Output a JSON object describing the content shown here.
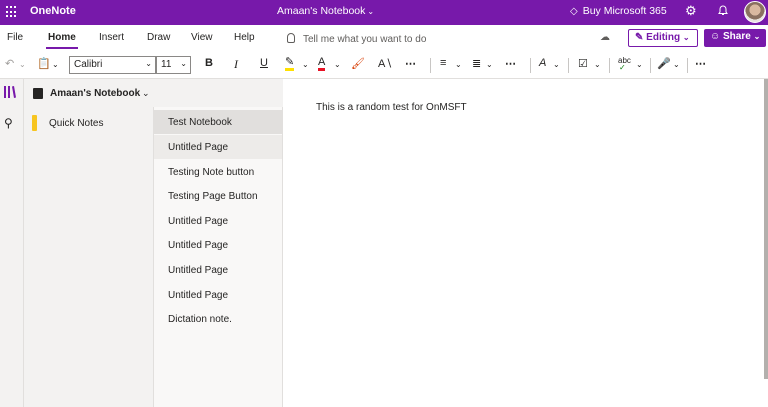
{
  "titlebar": {
    "app_name": "OneNote",
    "notebook_title": "Amaan's Notebook",
    "buy_label": "Buy Microsoft 365",
    "bg_color": "#7719aa"
  },
  "tabs": [
    {
      "label": "File"
    },
    {
      "label": "Home"
    },
    {
      "label": "Insert"
    },
    {
      "label": "Draw"
    },
    {
      "label": "View"
    },
    {
      "label": "Help"
    }
  ],
  "tellme_placeholder": "Tell me what you want to do",
  "editing_label": "Editing",
  "share_label": "Share",
  "toolbar": {
    "font_name": "Calibri",
    "font_size": "11",
    "bold": "B",
    "italic": "I",
    "underline": "U",
    "font_color": "A",
    "styles": "A",
    "spelling": "abc"
  },
  "notebook": {
    "name": "Amaan's Notebook"
  },
  "sections": [
    {
      "label": "Quick Notes",
      "color": "#f7c520"
    }
  ],
  "pages": [
    {
      "label": "Test Notebook"
    },
    {
      "label": "Untitled Page"
    },
    {
      "label": "Testing Note button"
    },
    {
      "label": "Testing Page Button"
    },
    {
      "label": "Untitled Page"
    },
    {
      "label": "Untitled Page"
    },
    {
      "label": "Untitled Page"
    },
    {
      "label": "Untitled Page"
    },
    {
      "label": "Dictation note."
    }
  ],
  "canvas": {
    "text": "This is a random test for OnMSFT"
  }
}
